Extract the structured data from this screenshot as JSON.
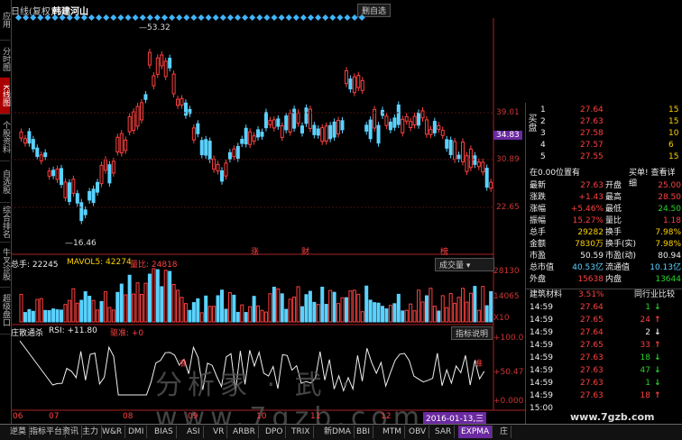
{
  "window": {
    "title_left": "日线(复权)",
    "stock_name": "韩建河山",
    "cancel_watch": "删自选"
  },
  "left_tabs": [
    "应用",
    "分时图",
    "K线图",
    "个股资料",
    "自选股",
    "综合排名",
    "牛叉诊股",
    "超级盘口"
  ],
  "price_axis": [
    "39.01",
    "34.83",
    "30.89",
    "22.65"
  ],
  "annotations": {
    "high": "53.32",
    "low": "16.46"
  },
  "markers": [
    "涨",
    "财",
    "榜"
  ],
  "volume": {
    "label": "总手: 22245",
    "mavol": "MAVOL5: 42274",
    "ratio": "量比: 24818",
    "menu": "成交量",
    "axis": [
      "28130",
      "14065",
      "X10"
    ]
  },
  "indicator": {
    "label": "庄散通杀",
    "rsi": "RSI: +11.80",
    "extra": "驱准: +0",
    "help": "指标说明",
    "axis": [
      "+100.0",
      "+50.47",
      "+0.000"
    ],
    "tag": "准"
  },
  "dates": [
    "06",
    "07",
    "08",
    "09",
    "10",
    "11",
    "12",
    "2016-01-13,三"
  ],
  "watermark": "分析家 ‧ 武 ‧ www.7gzb.com",
  "website": "www.7gzb.com",
  "order_book": {
    "side_label": "买盘",
    "rows": [
      {
        "n": "1",
        "price": "27.64",
        "vol": "15"
      },
      {
        "n": "2",
        "price": "27.63",
        "vol": "15"
      },
      {
        "n": "3",
        "price": "27.58",
        "vol": "10"
      },
      {
        "n": "4",
        "price": "27.57",
        "vol": "6"
      },
      {
        "n": "5",
        "price": "27.55",
        "vol": "15"
      }
    ]
  },
  "quote": {
    "position_text": "在0.00位置有",
    "buy_sell": "买单! 查看详细",
    "rows": [
      {
        "l1": "最新",
        "v1": "27.63",
        "c1": "red",
        "l2": "开盘",
        "v2": "25.00",
        "c2": "red"
      },
      {
        "l1": "涨跌",
        "v1": "+1.43",
        "c1": "red",
        "l2": "最高",
        "v2": "28.50",
        "c2": "red"
      },
      {
        "l1": "涨幅",
        "v1": "+5.46%",
        "c1": "red",
        "l2": "最低",
        "v2": "24.50",
        "c2": "green"
      },
      {
        "l1": "振幅",
        "v1": "15.27%",
        "c1": "red",
        "l2": "量比",
        "v2": "1.18",
        "c2": "red"
      },
      {
        "l1": "总手",
        "v1": "29282",
        "c1": "yellow",
        "l2": "换手",
        "v2": "7.98%",
        "c2": "yellow"
      },
      {
        "l1": "金额",
        "v1": "7830万",
        "c1": "yellow",
        "l2": "换手(实)",
        "v2": "7.98%",
        "c2": "yellow"
      },
      {
        "l1": "市盈",
        "v1": "50.59",
        "c1": "white",
        "l2": "市盈(动)",
        "v2": "80.94",
        "c2": "white"
      },
      {
        "l1": "总市值",
        "v1": "40.53亿",
        "c1": "cyan",
        "l2": "流通值",
        "v2": "10.13亿",
        "c2": "cyan"
      },
      {
        "l1": "外盘",
        "v1": "15638",
        "c1": "red",
        "l2": "内盘",
        "v2": "13644",
        "c2": "green"
      }
    ]
  },
  "sector": {
    "name": "建筑材料",
    "pct": "3.51%",
    "compare": "同行业比较"
  },
  "ticks": [
    {
      "t": "14:59",
      "p": "27.64",
      "v": "1",
      "arrow": "↓",
      "c": "green"
    },
    {
      "t": "14:59",
      "p": "27.65",
      "v": "24",
      "arrow": "↑",
      "c": "red"
    },
    {
      "t": "14:59",
      "p": "27.64",
      "v": "2",
      "arrow": "↓",
      "c": "white"
    },
    {
      "t": "14:59",
      "p": "27.65",
      "v": "33",
      "arrow": "↑",
      "c": "red"
    },
    {
      "t": "14:59",
      "p": "27.63",
      "v": "18",
      "arrow": "↓",
      "c": "green"
    },
    {
      "t": "14:59",
      "p": "27.63",
      "v": "47",
      "arrow": "↓",
      "c": "green"
    },
    {
      "t": "14:59",
      "p": "27.63",
      "v": "1",
      "arrow": "↓",
      "c": "green"
    },
    {
      "t": "14:59",
      "p": "27.63",
      "v": "18",
      "arrow": "↑",
      "c": "red"
    },
    {
      "t": "15:00",
      "p": "",
      "v": "",
      "arrow": "",
      "c": "white"
    }
  ],
  "bottom_tabs": [
    "逆莫",
    "指标平台",
    "资讯",
    "主力",
    "W&R",
    "DMI",
    "BIAS",
    "ASI",
    "VR",
    "ARBR",
    "DPO",
    "TRIX",
    "新DMA",
    "BBI",
    "MTM",
    "OBV",
    "SAR",
    "EXPMA",
    "庄"
  ],
  "bottom_active": "EXPMA",
  "colors": {
    "up": "#ff4040",
    "down": "#28d428",
    "accent": "#6b2aa0",
    "ma": "#ffd200"
  }
}
